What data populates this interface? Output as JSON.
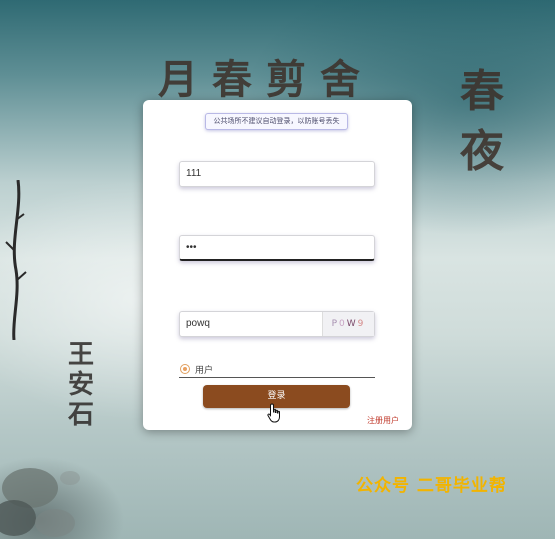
{
  "background": {
    "poem_title": "月春剪舍",
    "poem_title_vertical": [
      "春",
      "夜"
    ],
    "author": [
      "王",
      "安",
      "石"
    ]
  },
  "login": {
    "notice": "公共场所不建议自动登录，以防账号丢失",
    "username_value": "111",
    "password_mask": "•••",
    "code_value": "powq",
    "captcha": [
      "P",
      "0",
      "W",
      "9"
    ],
    "role_option": "用户",
    "login_button": "登录",
    "register_link": "注册用户"
  },
  "watermark": "公众号 二哥毕业帮",
  "colors": {
    "button": "#8b4b1f",
    "register_link": "#c0392b",
    "watermark": "#f2b400",
    "captcha": [
      "#a68fb0",
      "#c9a4c4",
      "#7b4a6b",
      "#d48a8a"
    ]
  }
}
